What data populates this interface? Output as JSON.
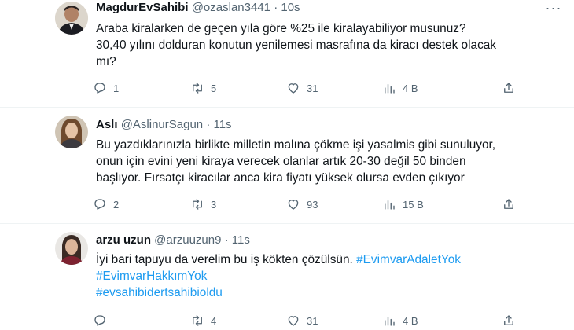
{
  "tweets": [
    {
      "name": "MagdurEvSahibi",
      "handle": "@ozaslan3441",
      "time": "10s",
      "dot": "·",
      "lines": [
        "Araba kiralarken de geçen yıla göre %25 ile kiralayabiliyor musunuz?",
        "30,40 yılını dolduran konutun yenilemesi masrafına da kiracı destek olacak",
        "mı?"
      ],
      "actions": {
        "replies": "1",
        "retweets": "5",
        "likes": "31",
        "views": "4 B"
      }
    },
    {
      "name": "Aslı",
      "handle": "@AslinurSagun",
      "time": "11s",
      "dot": "·",
      "lines": [
        "Bu yazdıklarınızla birlikte milletin malına çökme işi yasalmis gibi sunuluyor,",
        "onun için evini yeni kiraya verecek olanlar artık 20-30 değil 50 binden",
        "başlıyor. Fırsatçı kiracılar anca kira fiyatı yüksek olursa evden çıkıyor"
      ],
      "actions": {
        "replies": "2",
        "retweets": "3",
        "likes": "93",
        "views": "15 B"
      }
    },
    {
      "name": "arzu uzun",
      "handle": "@arzuuzun9",
      "time": "11s",
      "dot": "·",
      "text": "İyi bari tapuyu da verelim bu iş kökten çözülsün. ",
      "hashtags": [
        "#EvimvarAdaletYok",
        "#EvimvarHakkımYok",
        "#evsahibidertsahibioldu"
      ],
      "actions": {
        "replies": "",
        "retweets": "4",
        "likes": "31",
        "views": "4 B"
      }
    }
  ],
  "colors": {
    "text": "#0f1419",
    "secondary": "#536471",
    "link": "#1d9bf0",
    "separator": "#eff3f4"
  },
  "icons": [
    "reply-icon",
    "retweet-icon",
    "like-icon",
    "views-icon",
    "share-icon",
    "more-icon"
  ]
}
